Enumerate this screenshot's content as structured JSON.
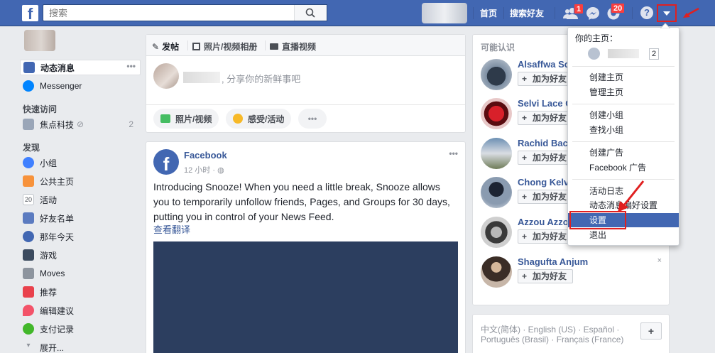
{
  "topbar": {
    "logo": "f",
    "search_placeholder": "搜索",
    "nav_home": "首页",
    "nav_find_friends": "搜索好友",
    "friend_requests_count": "1",
    "notifications_count": "20"
  },
  "left_nav": {
    "news_feed": "动态消息",
    "messenger": "Messenger",
    "shortcuts_heading": "快速访问",
    "shortcut_page": "焦点科技",
    "shortcut_count": "2",
    "explore_heading": "发现",
    "explore_items": [
      "小组",
      "公共主页",
      "活动",
      "好友名单",
      "那年今天",
      "游戏",
      "Moves",
      "推荐",
      "编辑建议",
      "支付记录"
    ],
    "see_more": "展开..."
  },
  "composer": {
    "tab_post": "发帖",
    "tab_album": "照片/视频相册",
    "tab_live": "直播视频",
    "prompt": ", 分享你的新鲜事吧",
    "btn_photo": "照片/视频",
    "btn_feeling": "感受/活动",
    "btn_more": "•••"
  },
  "post": {
    "author": "Facebook",
    "time": "12 小时 · ",
    "more": "•••",
    "text": "Introducing Snooze! When you need a little break, Snooze allows you to temporarily unfollow friends, Pages, and Groups for 30 days, putting you in control of your News Feed.",
    "translate": "查看翻译"
  },
  "pymk": {
    "heading": "可能认识",
    "add_label": "加为好友",
    "people": [
      "Alsaffwa So",
      "Selvi Lace G",
      "Rachid Bac",
      "Chong Kelv",
      "Azzou Azzo",
      "Shagufta Anjum"
    ]
  },
  "languages": {
    "line1": "中文(简体) · English (US) · Español ·",
    "line2": "Português (Brasil) · Français (France)",
    "add": "+"
  },
  "dropdown": {
    "your_pages": "你的主页：",
    "page_count": "2",
    "items": [
      "创建主页",
      "管理主页",
      "创建小组",
      "查找小组",
      "创建广告",
      "Facebook 广告",
      "活动日志",
      "动态消息偏好设置",
      "设置",
      "退出"
    ]
  },
  "colors": {
    "brand_blue": "#4267b2",
    "highlight_red": "#e02020"
  }
}
